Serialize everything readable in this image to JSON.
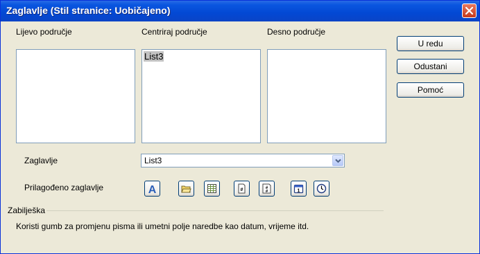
{
  "window": {
    "title": "Zaglavlje (Stil stranice: Uobičajeno)"
  },
  "areas": {
    "left_label": "Lijevo područje",
    "center_label": "Centriraj područje",
    "right_label": "Desno područje",
    "left_text": "",
    "center_text": "List3",
    "right_text": ""
  },
  "buttons": {
    "ok": "U redu",
    "cancel": "Odustani",
    "help": "Pomoć"
  },
  "header": {
    "label": "Zaglavlje",
    "value": "List3"
  },
  "custom": {
    "label": "Prilagođeno zaglavlje"
  },
  "toolbar": {
    "icons": [
      "font-attributes-icon",
      "file-name-icon",
      "sheet-name-icon",
      "page-icon",
      "pages-icon",
      "date-icon",
      "time-icon"
    ]
  },
  "note": {
    "title": "Zabilješka",
    "text": "Koristi gumb za promjenu pisma ili umetni polje naredbe kao datum, vrijeme itd."
  },
  "colors": {
    "titlebar": "#0348d4",
    "dialog_bg": "#ece9d8",
    "close": "#c6391b"
  }
}
